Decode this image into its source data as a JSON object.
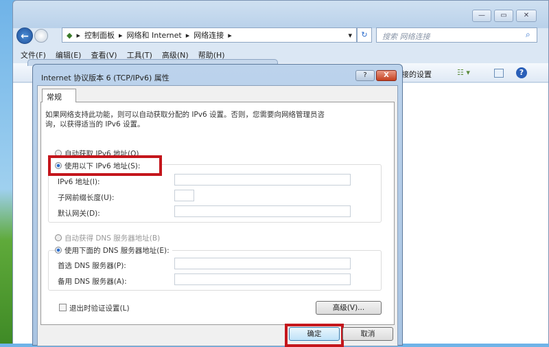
{
  "explorer": {
    "window_buttons": [
      "—",
      "▭",
      "✕"
    ],
    "breadcrumb": [
      "控制面板",
      "网络和 Internet",
      "网络连接"
    ],
    "search_placeholder": "搜索 网络连接",
    "menu": [
      "文件(F)",
      "编辑(E)",
      "查看(V)",
      "工具(T)",
      "高级(N)",
      "帮助(H)"
    ],
    "toolbar_partial_text": "接的设置"
  },
  "dialog": {
    "title": "Internet 协议版本 6 (TCP/IPv6) 属性",
    "help": "?",
    "close": "X",
    "tab": "常规",
    "description_line1": "如果网络支持此功能，则可以自动获取分配的 IPv6 设置。否则，您需要向网络管理员咨",
    "description_line2": "询，以获得适当的 IPv6 设置。",
    "auto_ip": "自动获取 IPv6 地址(O)",
    "manual_ip": "使用以下 IPv6 地址(S):",
    "ipv6_label": "IPv6 地址(I):",
    "ipv6_value": "",
    "prefix_label": "子网前缀长度(U):",
    "prefix_value": "",
    "gateway_label": "默认网关(D):",
    "gateway_value": "",
    "auto_dns": "自动获得 DNS 服务器地址(B)",
    "manual_dns": "使用下面的 DNS 服务器地址(E):",
    "preferred_dns_label": "首选 DNS 服务器(P):",
    "preferred_dns_value": "",
    "alternate_dns_label": "备用 DNS 服务器(A):",
    "alternate_dns_value": "",
    "validate_label": "退出时验证设置(L)",
    "advanced": "高级(V)...",
    "ok": "确定",
    "cancel": "取消",
    "selected_ip_mode": "manual",
    "selected_dns_mode": "manual",
    "validate_checked": false,
    "highlight_color": "#c4161c"
  }
}
